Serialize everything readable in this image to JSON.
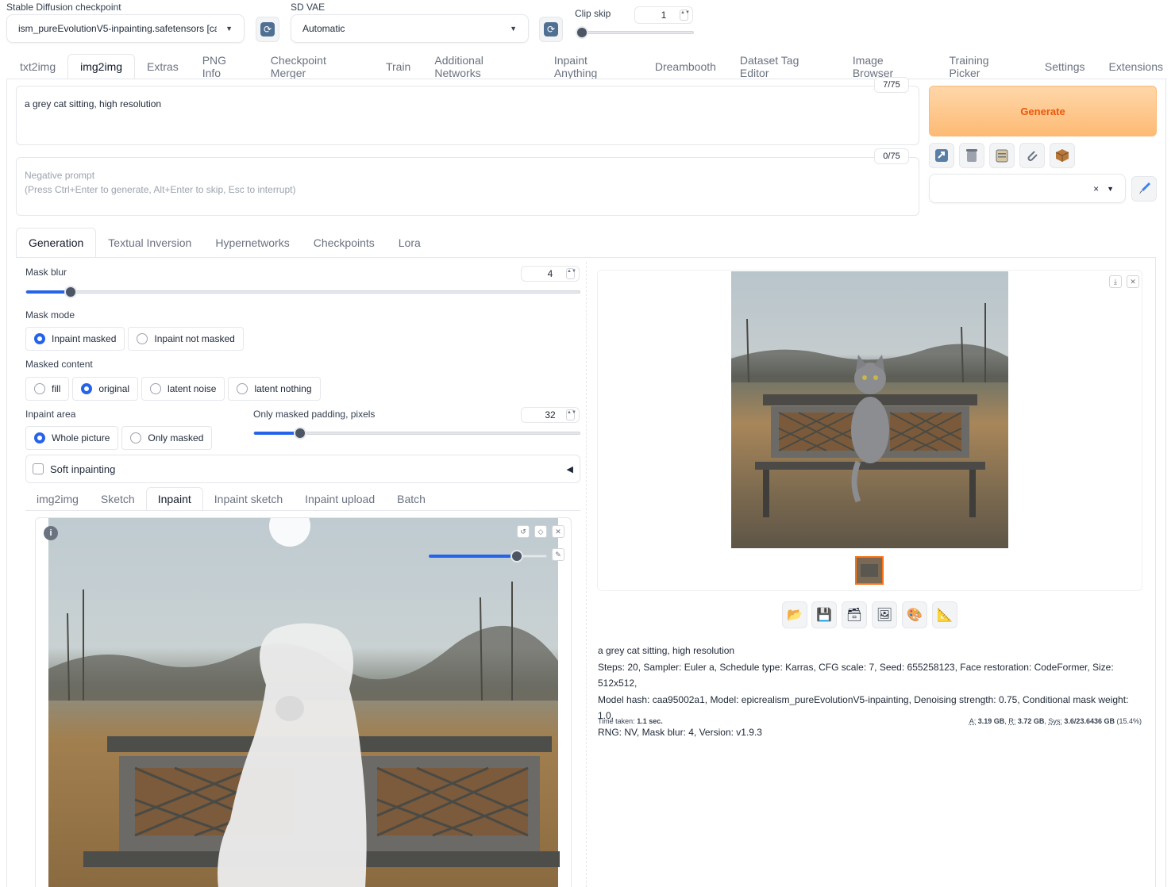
{
  "top": {
    "checkpoint_label": "Stable Diffusion checkpoint",
    "checkpoint_value": "ism_pureEvolutionV5-inpainting.safetensors [ca",
    "vae_label": "SD VAE",
    "vae_value": "Automatic",
    "clip_label": "Clip skip",
    "clip_value": "1",
    "clip_fraction": 0.0
  },
  "main_tabs": [
    "txt2img",
    "img2img",
    "Extras",
    "PNG Info",
    "Checkpoint Merger",
    "Train",
    "Additional Networks",
    "Inpaint Anything",
    "Dreambooth",
    "Dataset Tag Editor",
    "Image Browser",
    "Training Picker",
    "Settings",
    "Extensions"
  ],
  "prompt": {
    "value": "a grey cat sitting, high resolution",
    "counter": "7/75",
    "negative_placeholder": "Negative prompt\n(Press Ctrl+Enter to generate, Alt+Enter to skip, Esc to interrupt)",
    "negative_counter": "0/75"
  },
  "generate_label": "Generate",
  "sub_tabs": [
    "Generation",
    "Textual Inversion",
    "Hypernetworks",
    "Checkpoints",
    "Lora"
  ],
  "mask_blur": {
    "label": "Mask blur",
    "value": "4",
    "fraction": 0.08
  },
  "mask_mode": {
    "label": "Mask mode",
    "options": [
      "Inpaint masked",
      "Inpaint not masked"
    ]
  },
  "masked_content": {
    "label": "Masked content",
    "options": [
      "fill",
      "original",
      "latent noise",
      "latent nothing"
    ]
  },
  "inpaint_area": {
    "label": "Inpaint area",
    "options": [
      "Whole picture",
      "Only masked"
    ]
  },
  "padding": {
    "label": "Only masked padding, pixels",
    "value": "32",
    "fraction": 0.14
  },
  "soft_inpainting": "Soft inpainting",
  "image_tabs": [
    "img2img",
    "Sketch",
    "Inpaint",
    "Inpaint sketch",
    "Inpaint upload",
    "Batch"
  ],
  "brush_fraction": 0.74,
  "output": {
    "prompt": "a grey cat sitting, high resolution",
    "params": "Steps: 20, Sampler: Euler a, Schedule type: Karras, CFG scale: 7, Seed: 655258123, Face restoration: CodeFormer, Size: 512x512,",
    "params2": "Model hash: caa95002a1, Model: epicrealism_pureEvolutionV5-inpainting, Denoising strength: 0.75, Conditional mask weight: 1.0,",
    "params3": "RNG: NV, Mask blur: 4, Version: v1.9.3",
    "time_label": "Time taken:",
    "time_value": "1.1 sec.",
    "vram_a_label": "A:",
    "vram_a": "3.19 GB",
    "vram_r_label": "R:",
    "vram_r": "3.72 GB",
    "vram_sys_label": "Sys:",
    "vram_sys": "3.6/23.6436 GB",
    "vram_pct": "(15.4%)"
  }
}
